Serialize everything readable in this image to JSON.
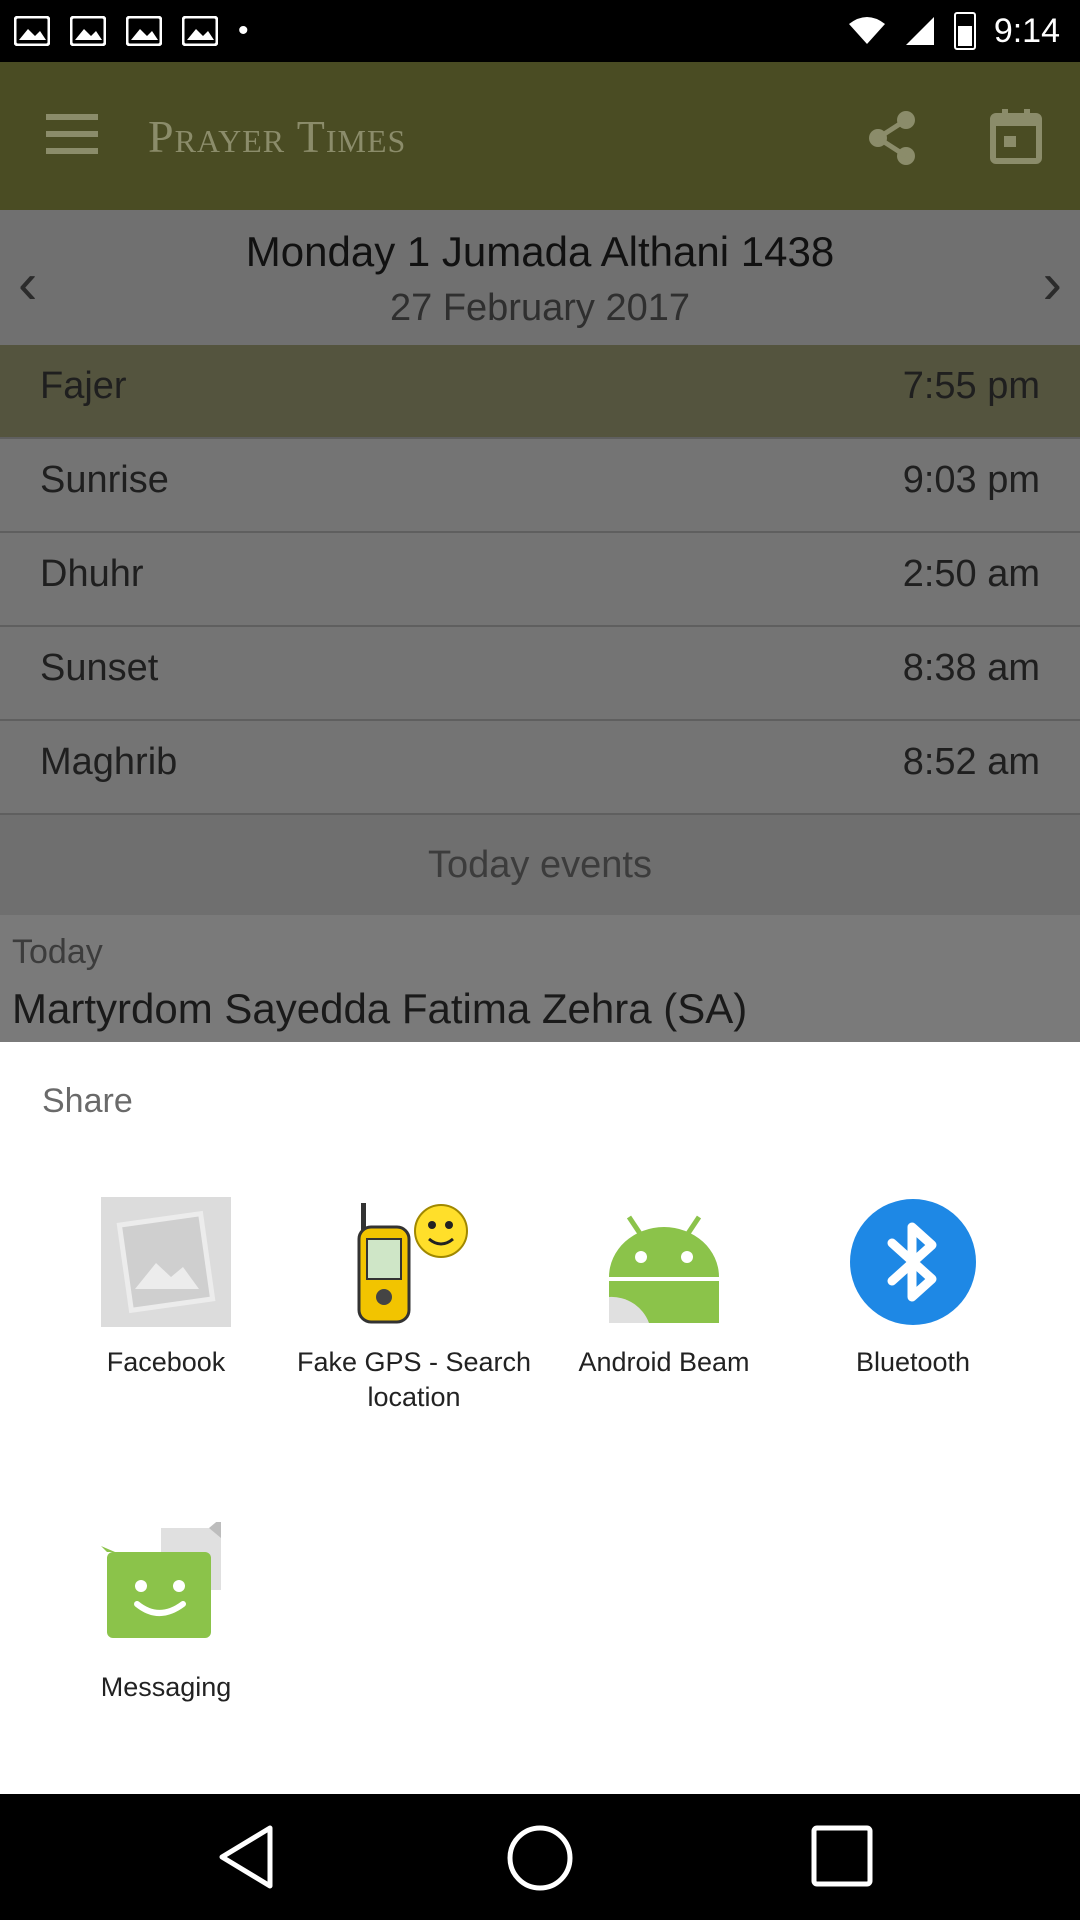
{
  "status_bar": {
    "time": "9:14"
  },
  "app_bar": {
    "title": "Prayer Times",
    "share_icon": "share-icon",
    "calendar_icon": "calendar-icon",
    "menu_icon": "menu-icon"
  },
  "date_header": {
    "hijri": "Monday 1 Jumada Althani 1438",
    "gregorian": "27 February 2017"
  },
  "prayers": [
    {
      "name": "Fajer",
      "time": "7:55 pm"
    },
    {
      "name": "Sunrise",
      "time": "9:03 pm"
    },
    {
      "name": "Dhuhr",
      "time": "2:50 am"
    },
    {
      "name": "Sunset",
      "time": "8:38 am"
    },
    {
      "name": "Maghrib",
      "time": "8:52 am"
    }
  ],
  "events": {
    "title": "Today events",
    "day_label": "Today",
    "event": "Martyrdom Sayedda Fatima Zehra (SA)"
  },
  "share_sheet": {
    "title": "Share",
    "apps": [
      {
        "label": "Facebook",
        "icon": "image-placeholder-icon"
      },
      {
        "label": "Fake GPS - Search location",
        "icon": "gps-device-icon"
      },
      {
        "label": "Android Beam",
        "icon": "android-icon"
      },
      {
        "label": "Bluetooth",
        "icon": "bluetooth-icon"
      },
      {
        "label": "Messaging",
        "icon": "messaging-icon"
      }
    ]
  },
  "colors": {
    "app_bar": "#4a4c23",
    "scrim_content": "#707070",
    "sheet_bg": "#ffffff",
    "bluetooth": "#1e88e5",
    "android_green": "#8bc34a"
  }
}
